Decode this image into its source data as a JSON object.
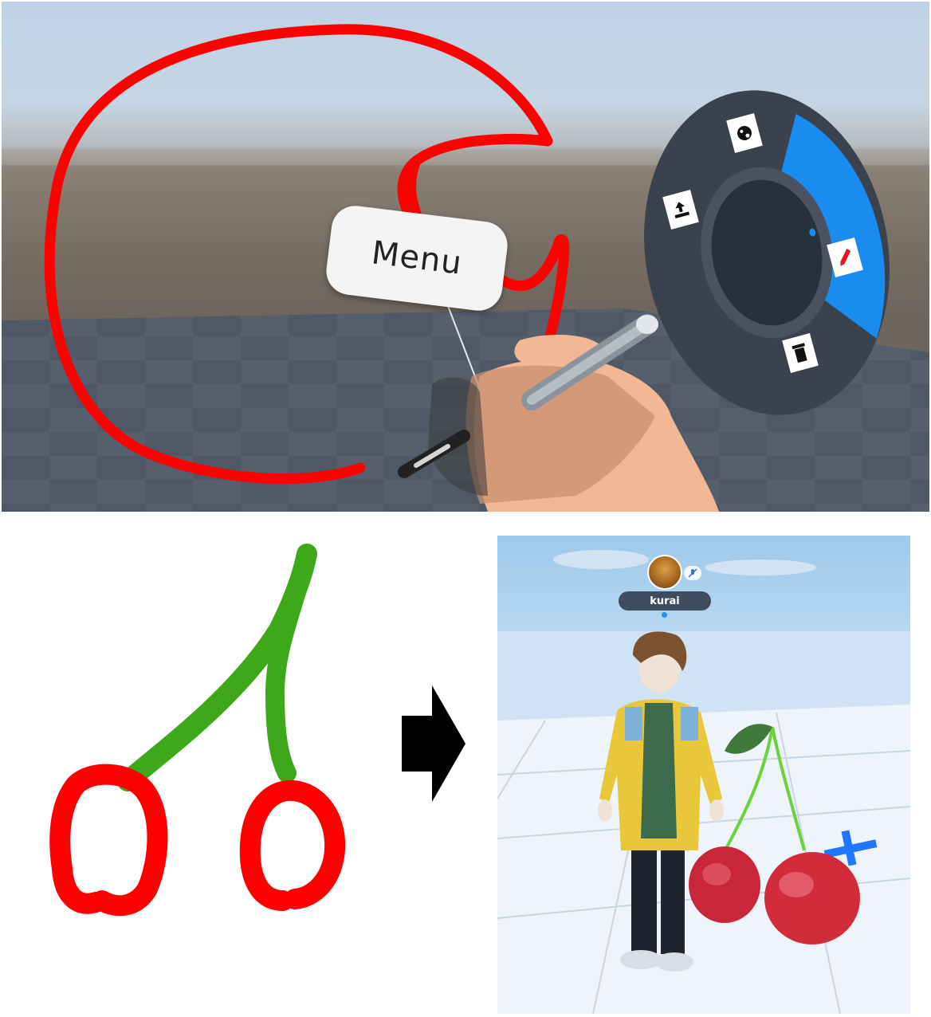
{
  "vr_menu": {
    "tooltip_label": "Menu",
    "radial_items": [
      {
        "icon": "palette-icon"
      },
      {
        "icon": "share-upload-icon"
      },
      {
        "icon": "pen-icon",
        "selected": true
      },
      {
        "icon": "trash-icon"
      }
    ],
    "colors": {
      "drawing_stroke": "#ff0000",
      "radial_base": "#3a4250",
      "radial_selected": "#1a8cf0"
    }
  },
  "sketch": {
    "stem_color": "#3ea81a",
    "fruit_color": "#ff0000"
  },
  "arrow": {
    "icon": "right-arrow-icon"
  },
  "scene": {
    "username": "kurai",
    "avatar_icon": "user-avatar-icon",
    "status_icon": "muted-mic-icon"
  }
}
